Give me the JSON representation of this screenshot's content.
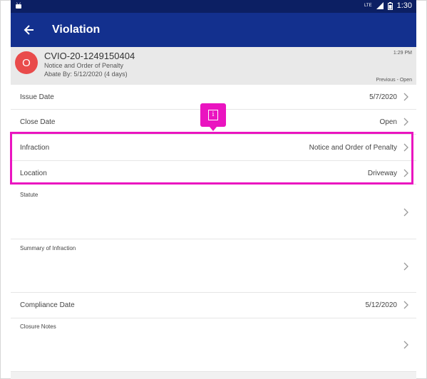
{
  "status_bar": {
    "signal_label": "LTE",
    "time": "1:30",
    "icons": [
      "android-icon",
      "signal-icon",
      "battery-icon"
    ]
  },
  "app_bar": {
    "title": "Violation",
    "back_icon": "back-arrow-icon"
  },
  "record": {
    "avatar_letter": "O",
    "id": "CVIO-20-1249150404",
    "subtitle": "Notice and Order of Penalty",
    "abate": "Abate By: 5/12/2020 (4 days)",
    "time": "1:29 PM",
    "nav": "Previous - Open"
  },
  "fields": [
    {
      "label": "Issue Date",
      "value": "5/7/2020"
    },
    {
      "label": "Close Date",
      "value": "Open"
    },
    {
      "label": "Infraction",
      "value": "Notice and Order of Penalty"
    },
    {
      "label": "Location",
      "value": "Driveway"
    },
    {
      "label": "Statute",
      "value": ""
    },
    {
      "label": "Summary of Infraction",
      "value": ""
    },
    {
      "label": "Compliance Date",
      "value": "5/12/2020"
    },
    {
      "label": "Closure Notes",
      "value": ""
    }
  ],
  "annotation": {
    "badge_glyph": "i",
    "color": "#ea14c0"
  },
  "colors": {
    "status_bar": "#0c1f63",
    "app_bar": "#13308e",
    "avatar": "#e94b4b",
    "header_bg": "#e9e9e9"
  }
}
